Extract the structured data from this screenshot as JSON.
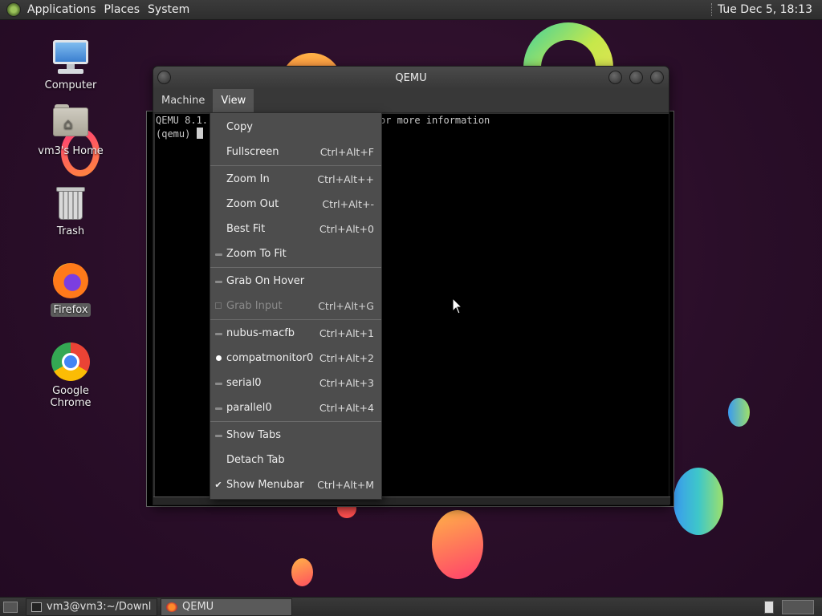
{
  "top_panel": {
    "menus": [
      "Applications",
      "Places",
      "System"
    ],
    "clock": "Tue Dec  5, 18:13"
  },
  "desktop": {
    "icons": [
      {
        "label": "Computer",
        "icon": "computer-icon"
      },
      {
        "label": "vm3's Home",
        "icon": "home-folder-icon"
      },
      {
        "label": "Trash",
        "icon": "trash-icon"
      },
      {
        "label": "Firefox",
        "icon": "firefox-icon"
      },
      {
        "label": "Google Chrome",
        "icon": "chrome-icon"
      }
    ]
  },
  "qemu_window": {
    "title": "QEMU",
    "menubar": [
      "Machine",
      "View"
    ],
    "console_lines": [
      "QEMU 8.1.",
      "(qemu) "
    ],
    "console_partial_text": "or more information"
  },
  "view_menu": {
    "items": [
      {
        "label": "Copy",
        "accel": "",
        "mark": "none"
      },
      {
        "label": "Fullscreen",
        "accel": "Ctrl+Alt+F",
        "mark": "none"
      },
      {
        "sep": true
      },
      {
        "label": "Zoom In",
        "accel": "Ctrl+Alt++",
        "mark": "none"
      },
      {
        "label": "Zoom Out",
        "accel": "Ctrl+Alt+-",
        "mark": "none"
      },
      {
        "label": "Best Fit",
        "accel": "Ctrl+Alt+0",
        "mark": "none"
      },
      {
        "label": "Zoom To Fit",
        "accel": "",
        "mark": "dash"
      },
      {
        "sep": true
      },
      {
        "label": "Grab On Hover",
        "accel": "",
        "mark": "dash"
      },
      {
        "label": "Grab Input",
        "accel": "Ctrl+Alt+G",
        "mark": "box",
        "disabled": true
      },
      {
        "sep": true
      },
      {
        "label": "nubus-macfb",
        "accel": "Ctrl+Alt+1",
        "mark": "dash"
      },
      {
        "label": "compatmonitor0",
        "accel": "Ctrl+Alt+2",
        "mark": "radio"
      },
      {
        "label": "serial0",
        "accel": "Ctrl+Alt+3",
        "mark": "dash"
      },
      {
        "label": "parallel0",
        "accel": "Ctrl+Alt+4",
        "mark": "dash"
      },
      {
        "sep": true
      },
      {
        "label": "Show Tabs",
        "accel": "",
        "mark": "dash"
      },
      {
        "label": "Detach Tab",
        "accel": "",
        "mark": "none"
      },
      {
        "label": "Show Menubar",
        "accel": "Ctrl+Alt+M",
        "mark": "check"
      }
    ]
  },
  "taskbar": {
    "tasks": [
      {
        "label": "vm3@vm3:~/Downl...",
        "icon": "terminal-icon",
        "active": false
      },
      {
        "label": "QEMU",
        "icon": "qemu-icon",
        "active": true
      }
    ]
  }
}
